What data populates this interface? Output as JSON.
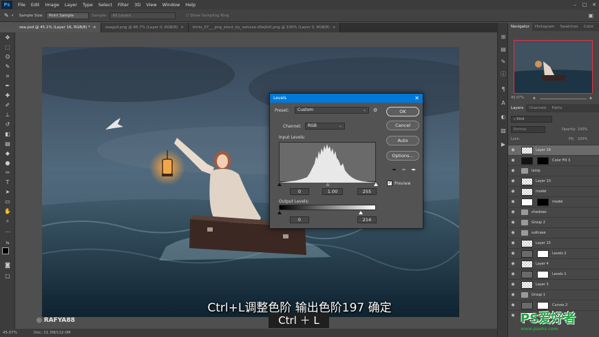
{
  "app": {
    "menu": [
      "File",
      "Edit",
      "Image",
      "Layer",
      "Type",
      "Select",
      "Filter",
      "3D",
      "View",
      "Window",
      "Help"
    ]
  },
  "options_bar": {
    "sample_size_label": "Sample Size:",
    "sample_size_value": "Point Sample",
    "sample_label": "Sample:",
    "sample_value": "All Layers",
    "show_ring_label": "Show Sampling Ring"
  },
  "tabs": [
    {
      "label": "sea.psd @ 45.1% (Layer 16, RGB/8) *",
      "active": true
    },
    {
      "label": "seagull.png @ 66.7% (Layer 0, RGB/8)",
      "active": false
    },
    {
      "label": "birds_07___png_stock_by_selussa-d9ejfo0.png @ 100% (Layer 0, RGB/8)",
      "active": false
    }
  ],
  "status": {
    "zoom": "45.07%",
    "doc": "Doc: 11.3M/112.0M"
  },
  "navigator": {
    "tabs": [
      "Navigator",
      "Histogram",
      "Swatches",
      "Color"
    ],
    "zoom": "45.07%"
  },
  "layers_panel": {
    "tabs": [
      "Layers",
      "Channels",
      "Paths"
    ],
    "kind_label": "Kind",
    "blend_mode": "Normal",
    "opacity_label": "Opacity:",
    "opacity_value": "100%",
    "lock_label": "Lock:",
    "fill_label": "Fill:",
    "fill_value": "100%",
    "layers": [
      {
        "name": "Layer 16",
        "kind": "pixel",
        "selected": true
      },
      {
        "name": "Color Fill 3",
        "kind": "fill"
      },
      {
        "name": "lamp",
        "kind": "group"
      },
      {
        "name": "Layer 10",
        "kind": "pixel"
      },
      {
        "name": "model",
        "kind": "pixel"
      },
      {
        "name": "model",
        "kind": "masked"
      },
      {
        "name": "shadows",
        "kind": "group"
      },
      {
        "name": "Group 2",
        "kind": "group"
      },
      {
        "name": "suitcase",
        "kind": "group"
      },
      {
        "name": "Layer 15",
        "kind": "pixel"
      },
      {
        "name": "Levels 2",
        "kind": "adjust"
      },
      {
        "name": "Layer 4",
        "kind": "pixel"
      },
      {
        "name": "Levels 1",
        "kind": "adjust"
      },
      {
        "name": "Layer 3",
        "kind": "pixel"
      },
      {
        "name": "Group 1",
        "kind": "group"
      },
      {
        "name": "Curves 2",
        "kind": "adjust"
      },
      {
        "name": "",
        "kind": "pixel"
      }
    ]
  },
  "levels_dialog": {
    "title": "Levels",
    "preset_label": "Preset:",
    "preset_value": "Custom",
    "channel_label": "Channel:",
    "channel_value": "RGB",
    "input_levels_label": "Input Levels:",
    "input_black": "0",
    "input_gamma": "1.00",
    "input_white": "255",
    "output_levels_label": "Output Levels:",
    "output_black": "0",
    "output_white": "214",
    "output_white_fraction": 0.84,
    "buttons": {
      "ok": "OK",
      "cancel": "Cancel",
      "auto": "Auto",
      "options": "Options..."
    },
    "preview_label": "Preview",
    "preview_checked": true
  },
  "overlay": {
    "subtitle": "Ctrl+L调整色阶  输出色阶197  确定",
    "keys": "Ctrl ＋ L",
    "credit": "RAFYA88",
    "watermark_big": "PS爱好者",
    "watermark_small": "www.psahz.com"
  }
}
